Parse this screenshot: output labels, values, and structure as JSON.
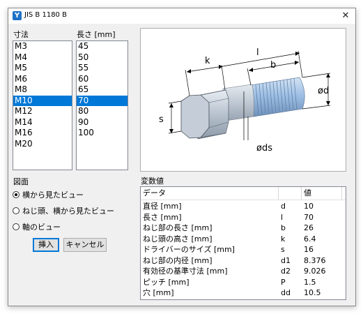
{
  "window": {
    "title": "JIS B 1180 B",
    "close_glyph": "✕"
  },
  "sizes": {
    "label": "寸法",
    "items": [
      "M3",
      "M4",
      "M5",
      "M6",
      "M8",
      "M10",
      "M12",
      "M14",
      "M16",
      "M20"
    ],
    "selected": "M10"
  },
  "lengths": {
    "label": "長さ [mm]",
    "items": [
      "45",
      "50",
      "55",
      "60",
      "65",
      "70",
      "80",
      "90",
      "100"
    ],
    "selected": "70"
  },
  "diagram": {
    "labels": {
      "l": "l",
      "b": "b",
      "k": "k",
      "d": "ød",
      "s": "s",
      "ds": "øds"
    }
  },
  "view": {
    "label": "図面",
    "options": [
      {
        "label": "横から見たビュー",
        "checked": true
      },
      {
        "label": "ねじ頭、横から見たビュー",
        "checked": false
      },
      {
        "label": "軸のビュー",
        "checked": false
      }
    ]
  },
  "buttons": {
    "insert": "挿入",
    "cancel": "キャンセル"
  },
  "variables": {
    "label": "変数値",
    "headers": [
      "データ",
      "",
      "値"
    ],
    "rows": [
      [
        "直径 [mm]",
        "d",
        "10"
      ],
      [
        "長さ [mm]",
        "l",
        "70"
      ],
      [
        "ねじ部の長さ [mm]",
        "b",
        "26"
      ],
      [
        "ねじ頭の高さ [mm]",
        "k",
        "6.4"
      ],
      [
        "ドライバーのサイズ [mm]",
        "s",
        "16"
      ],
      [
        "ねじ部の内径 [mm]",
        "d1",
        "8.376"
      ],
      [
        "有効径の基準寸法 [mm]",
        "d2",
        "9.026"
      ],
      [
        "ピッチ [mm]",
        "P",
        "1.5"
      ],
      [
        "穴 [mm]",
        "dd",
        "10.5"
      ]
    ]
  },
  "colors": {
    "accent": "#0078d7",
    "bolt": "#aeb9c6",
    "thread": "#8fb4de"
  }
}
